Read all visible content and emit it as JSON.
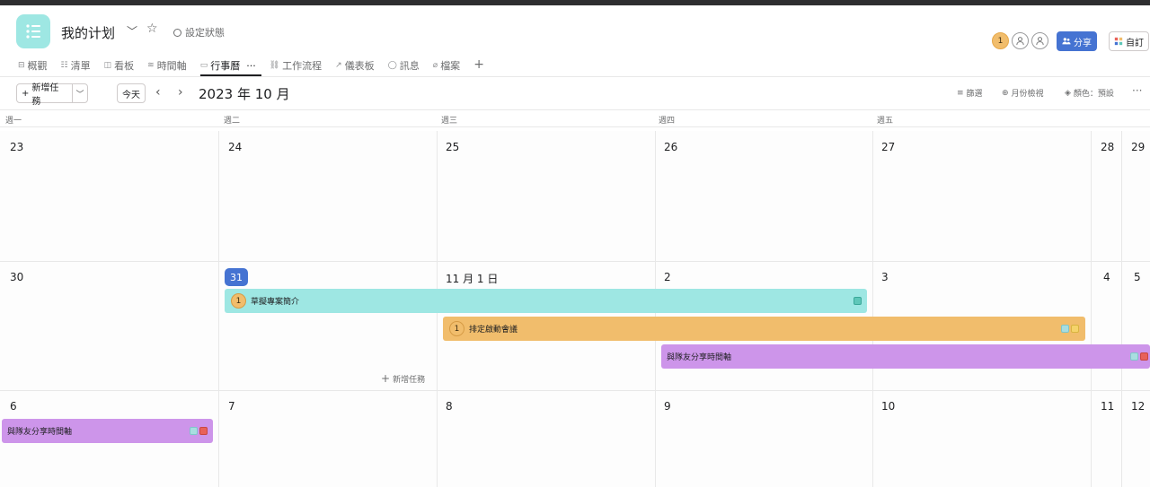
{
  "project": {
    "title": "我的计划",
    "status_label": "設定狀態"
  },
  "header": {
    "avatar_initial": "1",
    "share_label": "分享",
    "customize_label": "自訂"
  },
  "tabs": [
    {
      "label": "概觀",
      "icon": "overview-icon"
    },
    {
      "label": "清單",
      "icon": "list-icon"
    },
    {
      "label": "看板",
      "icon": "board-icon"
    },
    {
      "label": "時間軸",
      "icon": "timeline-icon"
    },
    {
      "label": "行事曆",
      "icon": "calendar-icon",
      "active": true
    },
    {
      "label": "工作流程",
      "icon": "workflow-icon"
    },
    {
      "label": "儀表板",
      "icon": "dashboard-icon"
    },
    {
      "label": "訊息",
      "icon": "message-icon"
    },
    {
      "label": "檔案",
      "icon": "attachment-icon"
    }
  ],
  "toolbar": {
    "add_task": "新增任務",
    "today": "今天",
    "month_title": "2023 年 10 月",
    "filter": "篩選",
    "month_view": "月份檢視",
    "color": "顏色：預設"
  },
  "weekdays": [
    "週一",
    "週二",
    "週三",
    "週四",
    "週五"
  ],
  "weeks": [
    [
      "23",
      "24",
      "25",
      "26",
      "27",
      "28",
      "29"
    ],
    [
      "30",
      "31",
      "11 月 1 日",
      "2",
      "3",
      "4",
      "5"
    ],
    [
      "6",
      "7",
      "8",
      "9",
      "10",
      "11",
      "12"
    ]
  ],
  "events": [
    {
      "title": "草擬專案簡介",
      "assignee": "1",
      "color": "#9ee7e3"
    },
    {
      "title": "排定啟動會議",
      "assignee": "1",
      "color": "#f1bd6c"
    },
    {
      "title": "與隊友分享時間軸",
      "assignee": "",
      "color": "#cd95ea"
    },
    {
      "title": "與隊友分享時間軸",
      "assignee": "",
      "color": "#cd95ea"
    }
  ],
  "inline_add_task": "新增任務",
  "colors": {
    "accent": "#4573d2",
    "today": "#4573d2"
  }
}
